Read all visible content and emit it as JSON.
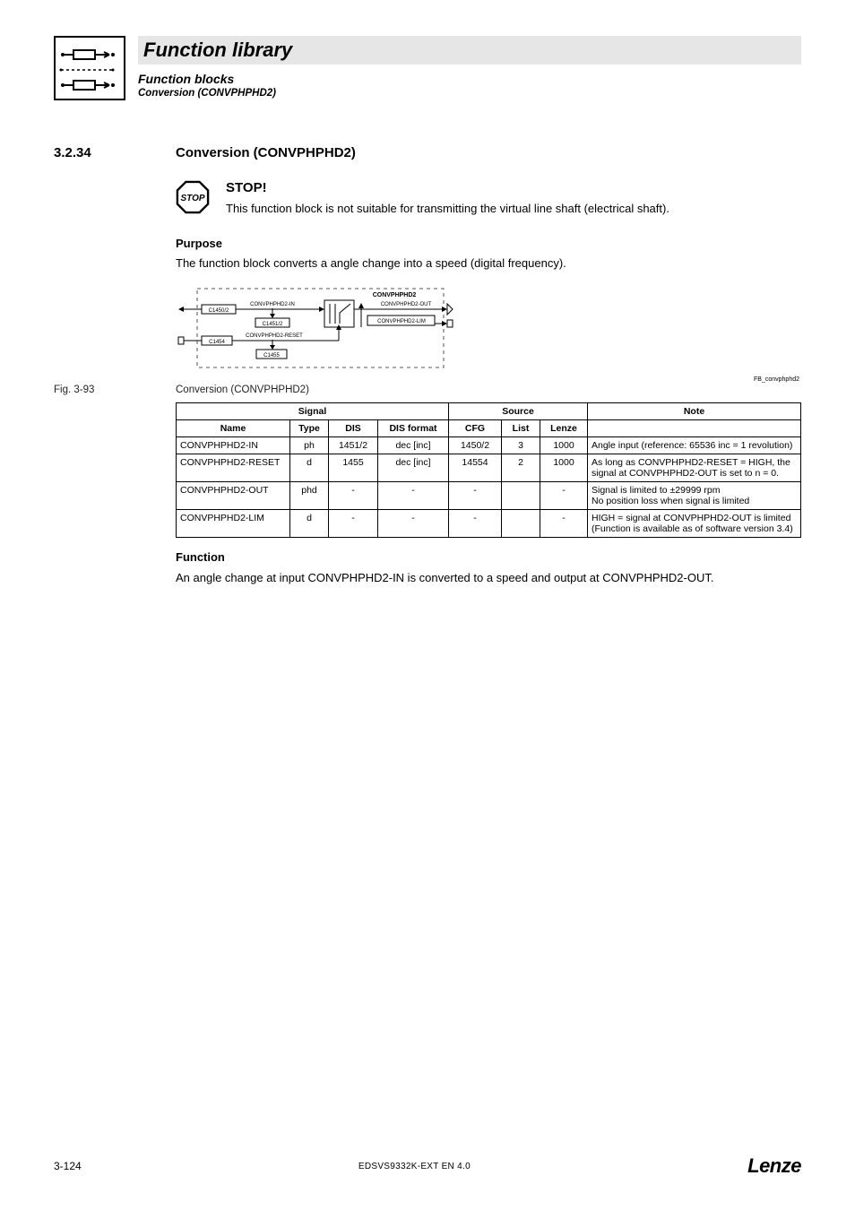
{
  "header": {
    "title": "Function library",
    "subtitle1": "Function blocks",
    "subtitle2": "Conversion (CONVPHPHD2)"
  },
  "section": {
    "number": "3.2.34",
    "title": "Conversion (CONVPHPHD2)"
  },
  "stop": {
    "label": "STOP",
    "heading": "STOP!",
    "text": "This function block is not suitable for transmitting the virtual line shaft (electrical shaft)."
  },
  "purpose": {
    "heading": "Purpose",
    "text": "The function block converts a angle change into a speed (digital frequency)."
  },
  "diagram": {
    "block": "CONVPHPHD2",
    "in_label": "CONVPHPHD2-IN",
    "in_code_top": "C1450/2",
    "in_code_bot": "C1451/2",
    "reset_label": "CONVPHPHD2-RESET",
    "reset_code_top": "C1454",
    "reset_code_bot": "C1455",
    "out_label": "CONVPHPHD2-OUT",
    "lim_label": "CONVPHPHD2-LIM",
    "fb_tag": "FB_convphphd2"
  },
  "figure": {
    "label": "Fig. 3-93",
    "caption": "Conversion (CONVPHPHD2)"
  },
  "table": {
    "group_signal": "Signal",
    "group_source": "Source",
    "group_note": "Note",
    "cols": {
      "name": "Name",
      "type": "Type",
      "dis": "DIS",
      "disf": "DIS format",
      "cfg": "CFG",
      "list": "List",
      "lenze": "Lenze"
    },
    "rows": [
      {
        "name": "CONVPHPHD2-IN",
        "type": "ph",
        "dis": "1451/2",
        "disf": "dec [inc]",
        "cfg": "1450/2",
        "list": "3",
        "lenze": "1000",
        "note": "Angle input (reference: 65536 inc = 1 revolution)"
      },
      {
        "name": "CONVPHPHD2-RESET",
        "type": "d",
        "dis": "1455",
        "disf": "dec [inc]",
        "cfg": "14554",
        "list": "2",
        "lenze": "1000",
        "note": "As long as CONVPHPHD2-RESET = HIGH, the signal at CONVPHPHD2-OUT is set to n = 0."
      },
      {
        "name": "CONVPHPHD2-OUT",
        "type": "phd",
        "dis": "-",
        "disf": "-",
        "cfg": "-",
        "list": "",
        "lenze": "-",
        "note": "Signal is limited to ±29999 rpm\nNo position loss when signal is limited"
      },
      {
        "name": "CONVPHPHD2-LIM",
        "type": "d",
        "dis": "-",
        "disf": "-",
        "cfg": "-",
        "list": "",
        "lenze": "-",
        "note": "HIGH = signal at CONVPHPHD2-OUT is limited\n(Function is available as of software version 3.4)"
      }
    ]
  },
  "function": {
    "heading": "Function",
    "text": "An angle change at input CONVPHPHD2-IN is converted to a speed and output at CONVPHPHD2-OUT."
  },
  "footer": {
    "page": "3-124",
    "docid": "EDSVS9332K-EXT EN 4.0",
    "brand": "Lenze"
  }
}
